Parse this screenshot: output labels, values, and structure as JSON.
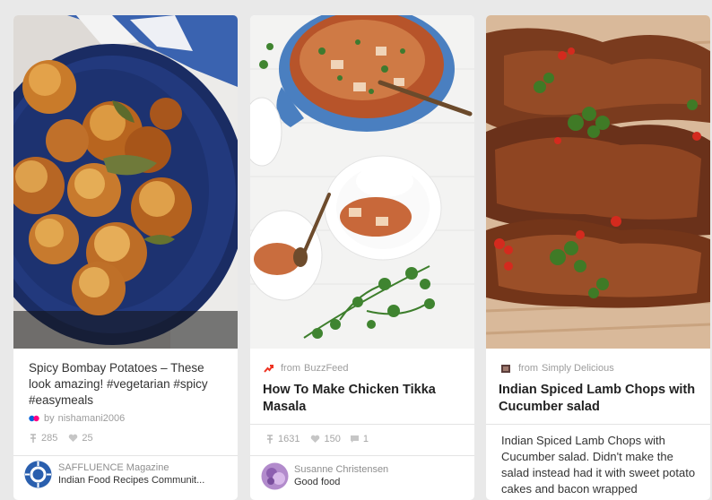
{
  "pins": [
    {
      "description": "Spicy Bombay Potatoes – These look amazing! #vegetarian #spicy #easymeals",
      "pinner_prefix": "by",
      "pinner": "nishamani2006",
      "repins": "285",
      "likes": "25",
      "board_name": "SAFFLUENCE Magazine",
      "board_sub": "Indian Food Recipes Communit..."
    },
    {
      "source_prefix": "from",
      "source": "BuzzFeed",
      "title": "How To Make Chicken Tikka Masala",
      "repins": "1631",
      "likes": "150",
      "comments": "1",
      "user_name": "Susanne Christensen",
      "user_board": "Good food"
    },
    {
      "source_prefix": "from",
      "source": "Simply Delicious",
      "title": "Indian Spiced Lamb Chops with Cucumber salad",
      "description": "Indian Spiced Lamb Chops with Cucumber salad. Didn't make the salad instead had it with sweet potato cakes and bacon wrapped"
    }
  ],
  "icons": {
    "repin": "pin-icon",
    "like": "heart-icon",
    "comment": "comment-icon"
  }
}
